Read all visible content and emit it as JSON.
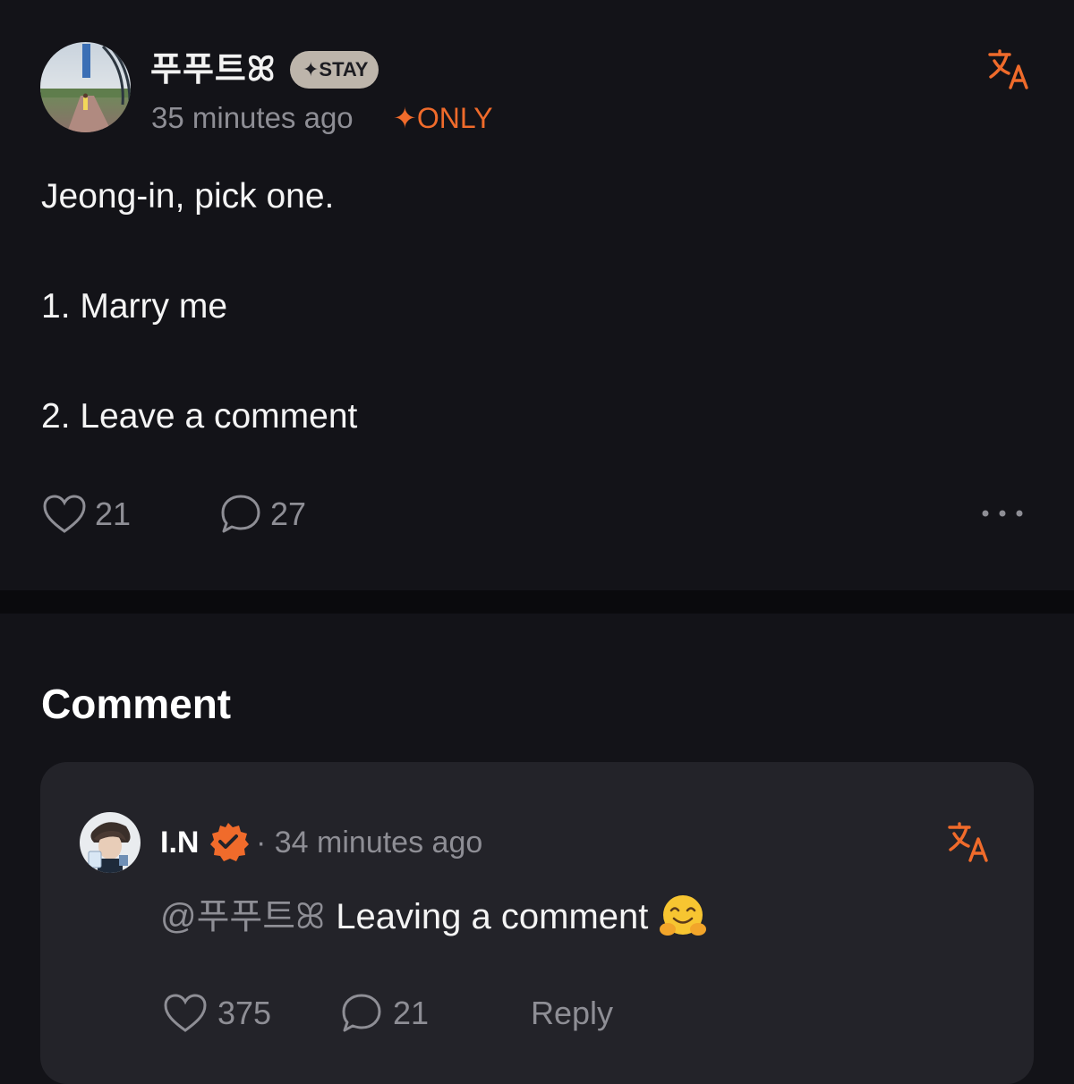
{
  "colors": {
    "background": "#131318",
    "card": "#232329",
    "accent": "#f06b2b",
    "muted": "#8e8e95",
    "badge": "#bdb5ab"
  },
  "post": {
    "author": "푸푸트ꕤ",
    "badge": "✦STAY",
    "time": "35 minutes ago",
    "visibility": "✦ONLY",
    "translate_icon": "translate-icon",
    "lines": [
      "Jeong-in, pick one.",
      "1. Marry me",
      "2. Leave a comment"
    ],
    "likes": "21",
    "comments": "27",
    "more_icon": "more-horizontal-icon"
  },
  "comments_section": {
    "title": "Comment"
  },
  "comment": {
    "author": "I.N",
    "verified_icon": "verified-badge-icon",
    "time": "· 34 minutes ago",
    "mention": "@푸푸트ꕤ",
    "text": "Leaving a comment",
    "emoji": "hugging-face",
    "likes": "375",
    "replies": "21",
    "reply_label": "Reply"
  }
}
